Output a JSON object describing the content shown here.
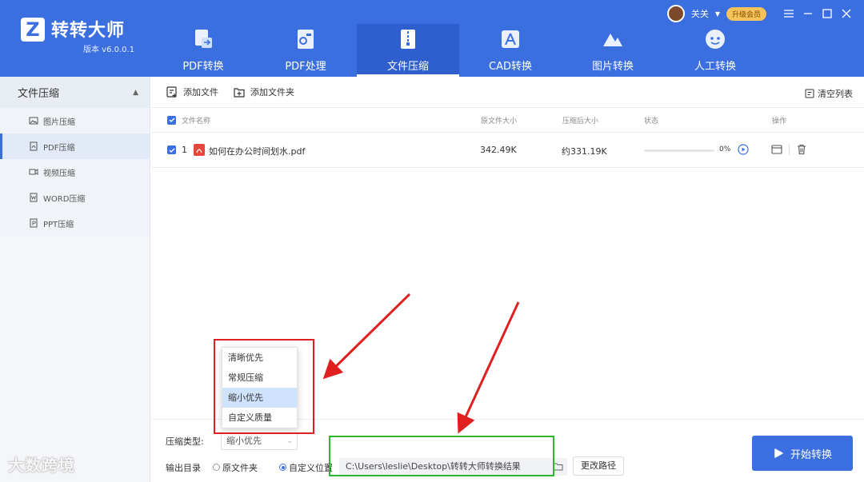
{
  "app": {
    "name": "转转大师",
    "version": "版本 v6.0.0.1",
    "user_label": "关关",
    "vip_label": "升级会员"
  },
  "nav": [
    {
      "label": "PDF转换",
      "icon": "pdf-convert-icon"
    },
    {
      "label": "PDF处理",
      "icon": "pdf-process-icon"
    },
    {
      "label": "文件压缩",
      "icon": "file-compress-icon",
      "active": true
    },
    {
      "label": "CAD转换",
      "icon": "cad-convert-icon"
    },
    {
      "label": "图片转换",
      "icon": "image-convert-icon"
    },
    {
      "label": "人工转换",
      "icon": "manual-convert-icon"
    }
  ],
  "sidebar": {
    "title": "文件压缩",
    "items": [
      {
        "label": "图片压缩",
        "icon": "image-icon"
      },
      {
        "label": "PDF压缩",
        "icon": "pdf-icon",
        "active": true
      },
      {
        "label": "视频压缩",
        "icon": "video-icon"
      },
      {
        "label": "WORD压缩",
        "icon": "word-icon"
      },
      {
        "label": "PPT压缩",
        "icon": "ppt-icon"
      }
    ]
  },
  "toolbar": {
    "add_file": "添加文件",
    "add_folder": "添加文件夹",
    "clear_list": "清空列表"
  },
  "table": {
    "headers": {
      "name": "文件名称",
      "original_size": "原文件大小",
      "compressed_size": "压缩后大小",
      "status": "状态",
      "actions": "操作"
    },
    "rows": [
      {
        "index": "1",
        "name": "如何在办公时间划水.pdf",
        "original_size": "342.49K",
        "compressed_size": "约331.19K",
        "progress": "0%",
        "progress_value": 0
      }
    ]
  },
  "compression": {
    "type_label": "压缩类型:",
    "selected": "缩小优先",
    "options": [
      "清晰优先",
      "常规压缩",
      "缩小优先",
      "自定义质量"
    ]
  },
  "output": {
    "label": "输出目录",
    "option_original": "原文件夹",
    "option_custom": "自定义位置",
    "path": "C:\\Users\\leslie\\Desktop\\转转大师转换结果",
    "change_path": "更改路径"
  },
  "start_button": "开始转换",
  "watermark": "大数跨境",
  "colors": {
    "brand": "#3b6fe0",
    "annotation_red": "#e02020",
    "annotation_green": "#2fb52f"
  }
}
